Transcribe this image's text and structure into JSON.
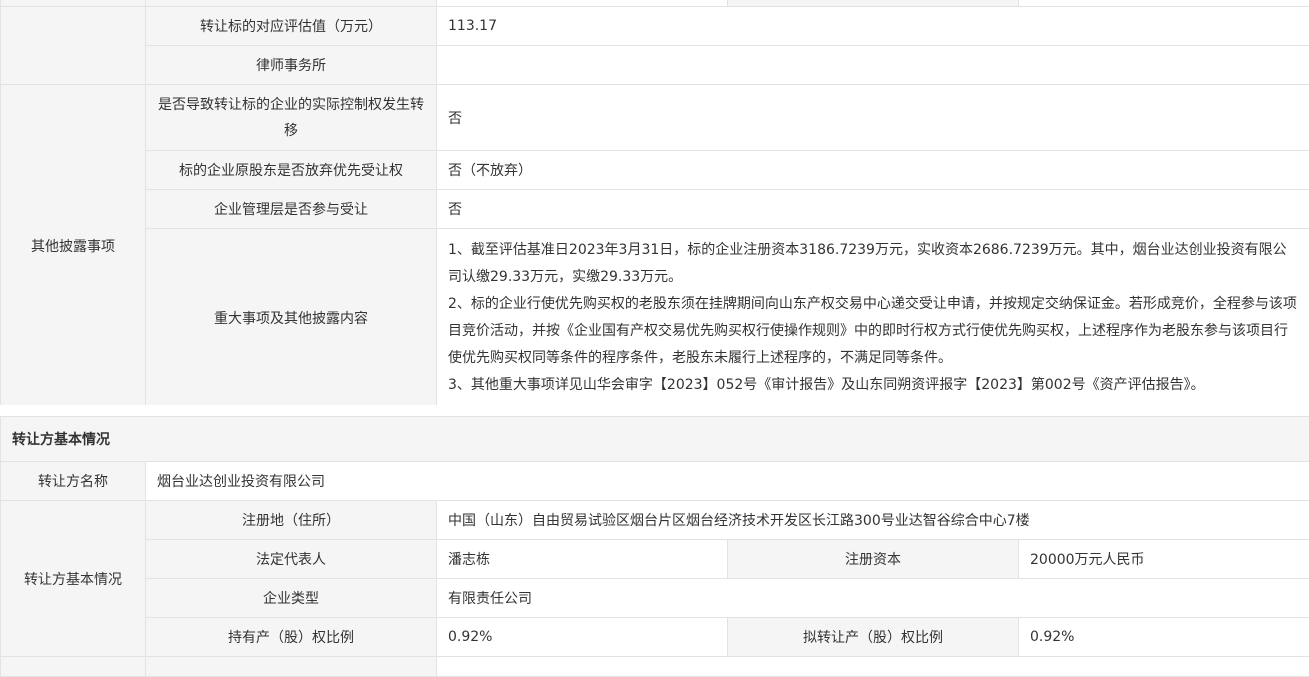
{
  "top_table": {
    "rows": [
      {
        "label": "转让标的对应评估值（万元）",
        "value": "113.17"
      },
      {
        "label": "律师事务所",
        "value": ""
      }
    ],
    "group_label": "其他披露事项",
    "group_rows": [
      {
        "label": "是否导致转让标的企业的实际控制权发生转移",
        "value": "否"
      },
      {
        "label": "标的企业原股东是否放弃优先受让权",
        "value": "否（不放弃）"
      },
      {
        "label": "企业管理层是否参与受让",
        "value": "否"
      },
      {
        "label": "重大事项及其他披露内容",
        "paragraphs": [
          "1、截至评估基准日2023年3月31日，标的企业注册资本3186.7239万元，实收资本2686.7239万元。其中，烟台业达创业投资有限公司认缴29.33万元，实缴29.33万元。",
          "2、标的企业行使优先购买权的老股东须在挂牌期间向山东产权交易中心递交受让申请，并按规定交纳保证金。若形成竞价，全程参与该项目竞价活动，并按《企业国有产权交易优先购买权行使操作规则》中的即时行权方式行使优先购买权，上述程序作为老股东参与该项目行使优先购买权同等条件的程序条件，老股东未履行上述程序的，不满足同等条件。",
          "3、其他重大事项详见山华会审字【2023】052号《审计报告》及山东同朔资评报字【2023】第002号《资产评估报告》。"
        ]
      }
    ]
  },
  "transferor": {
    "section_title": "转让方基本情况",
    "name_label": "转让方名称",
    "name_value": "烟台业达创业投资有限公司",
    "group_label": "转让方基本情况",
    "address_label": "注册地（住所）",
    "address_value": "中国（山东）自由贸易试验区烟台片区烟台经济技术开发区长江路300号业达智谷综合中心7楼",
    "legal_rep_label": "法定代表人",
    "legal_rep_value": "潘志栋",
    "reg_capital_label": "注册资本",
    "reg_capital_value": "20000万元人民币",
    "company_type_label": "企业类型",
    "company_type_value": "有限责任公司",
    "holding_ratio_label": "持有产（股）权比例",
    "holding_ratio_value": "0.92%",
    "transfer_ratio_label": "拟转让产（股）权比例",
    "transfer_ratio_value": "0.92%"
  }
}
